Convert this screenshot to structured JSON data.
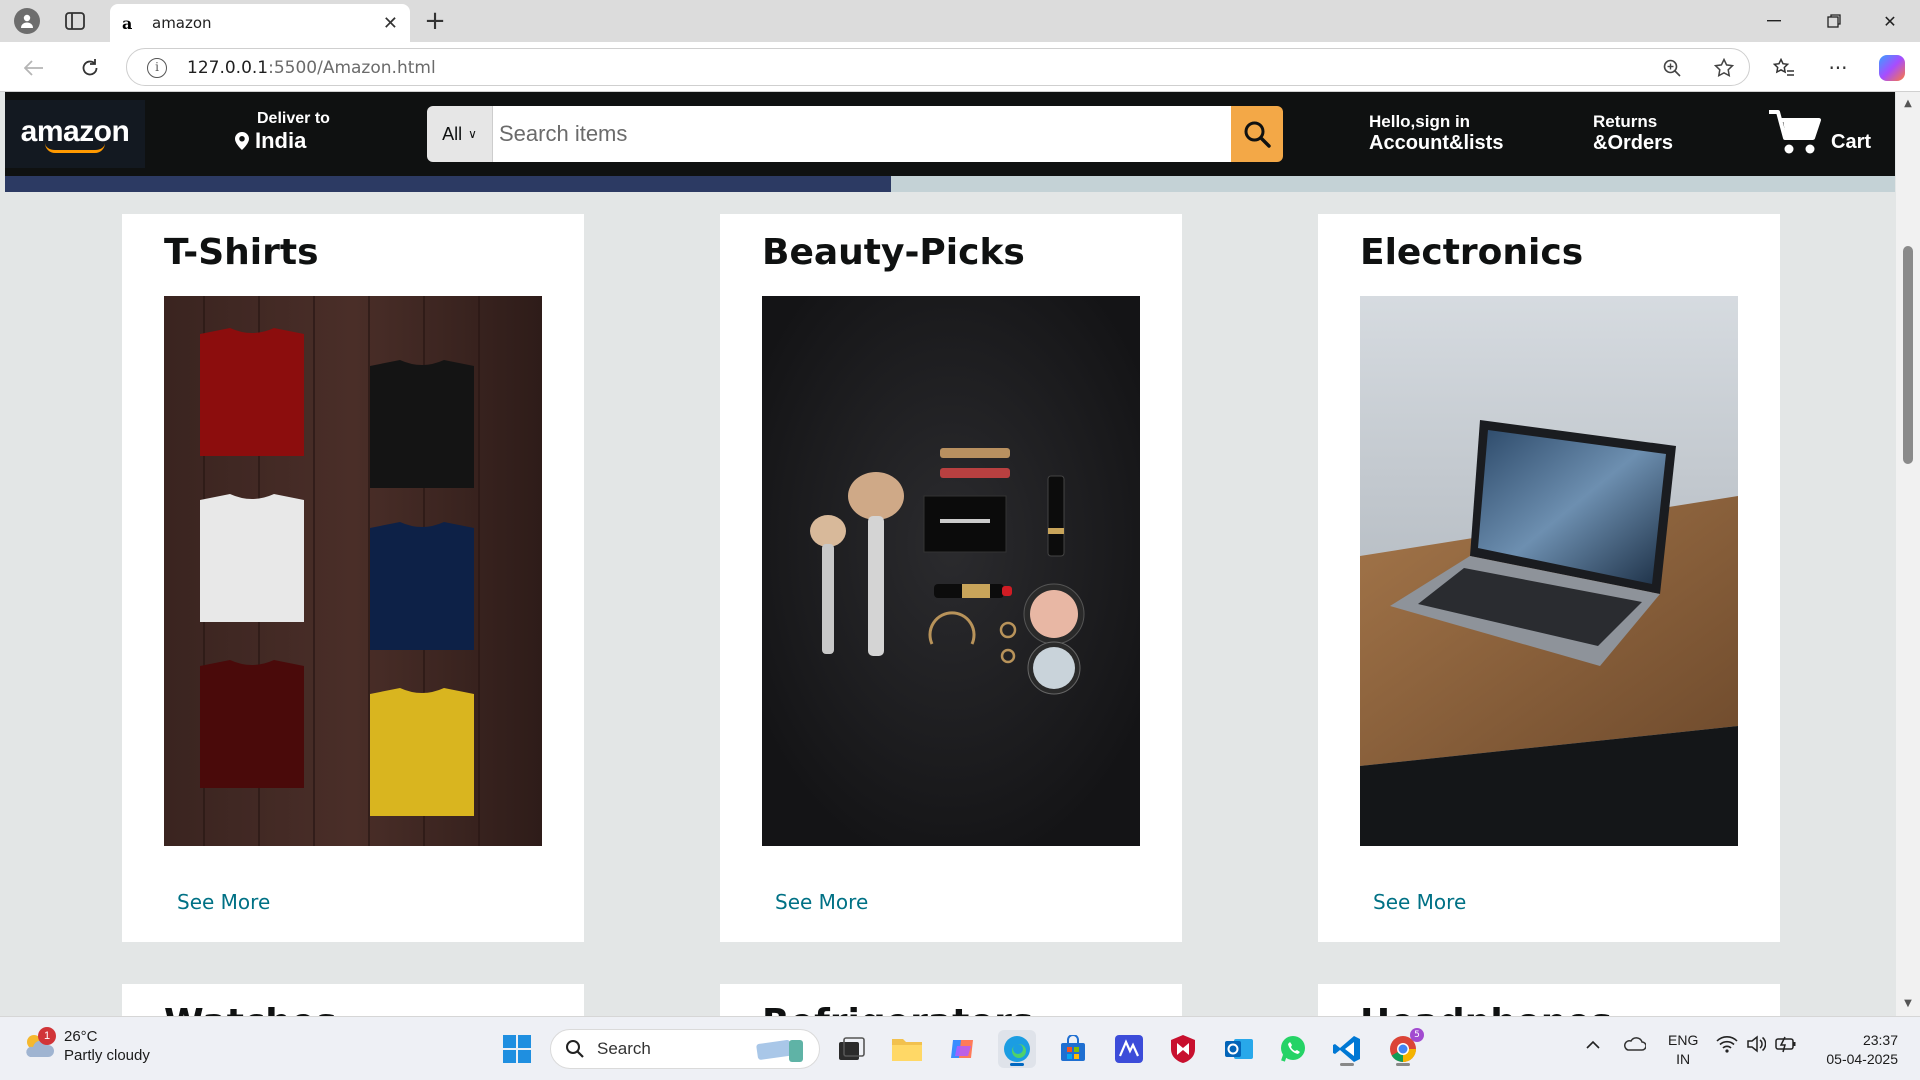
{
  "browser": {
    "tab_title": "amazon",
    "favicon": "a",
    "url_host": "127.0.0.1",
    "url_rest": ":5500/Amazon.html"
  },
  "navbar": {
    "logo": "amazon",
    "deliver_label": "Deliver to",
    "deliver_location": "India",
    "search_category": "All",
    "search_placeholder": "Search items",
    "account_line1": "Hello,sign in",
    "account_line2": "Account&lists",
    "returns_line1": "Returns",
    "returns_line2": "&Orders",
    "cart_label": "Cart"
  },
  "cards": [
    {
      "title": "T-Shirts",
      "link": "See More"
    },
    {
      "title": "Beauty-Picks",
      "link": "See More"
    },
    {
      "title": "Electronics",
      "link": "See More"
    }
  ],
  "row2_cards": [
    {
      "title": "Watches"
    },
    {
      "title": "Refrigerators"
    },
    {
      "title": "Headphones"
    }
  ],
  "taskbar": {
    "weather_temp": "26°C",
    "weather_desc": "Partly cloudy",
    "weather_badge": "1",
    "search_label": "Search",
    "lang1": "ENG",
    "lang2": "IN",
    "time": "23:37",
    "date": "05-04-2025",
    "chrome_badge": "5"
  },
  "colors": {
    "nav_bg": "#0f1111",
    "search_button": "#f3a847",
    "link": "#007185",
    "page_bg": "#e3e6e6"
  }
}
